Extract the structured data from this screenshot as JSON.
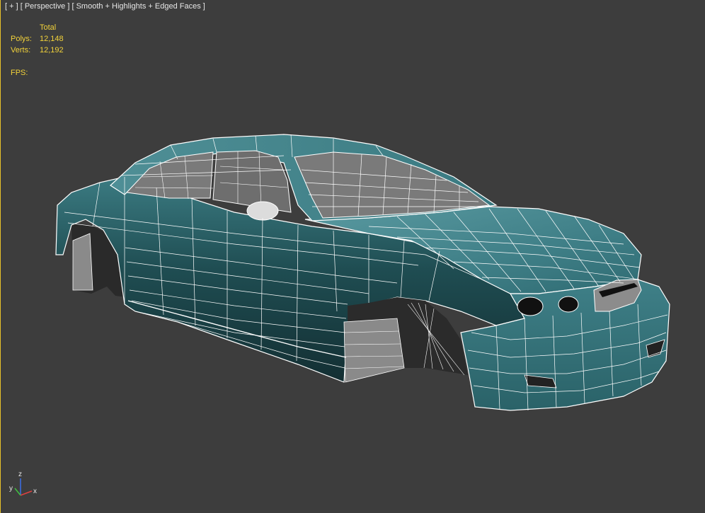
{
  "viewport": {
    "label_menu": "[ + ]",
    "label_view": "[ Perspective ]",
    "label_shading": "[ Smooth + Highlights + Edged Faces ]"
  },
  "stats": {
    "header": "Total",
    "polys_label": "Polys:",
    "polys_value": "12,148",
    "verts_label": "Verts:",
    "verts_value": "12,192",
    "fps_label": "FPS:"
  },
  "gizmo": {
    "x_label": "x",
    "y_label": "y",
    "z_label": "z"
  },
  "colors": {
    "viewport_bg": "#3d3d3d",
    "active_border": "#e8c22a",
    "stats_text": "#f2d23a",
    "body_teal": "#2f6d73",
    "body_dark": "#173a3e",
    "wire": "#ffffff"
  },
  "model": {
    "object": "sedan-car-body-mesh"
  }
}
